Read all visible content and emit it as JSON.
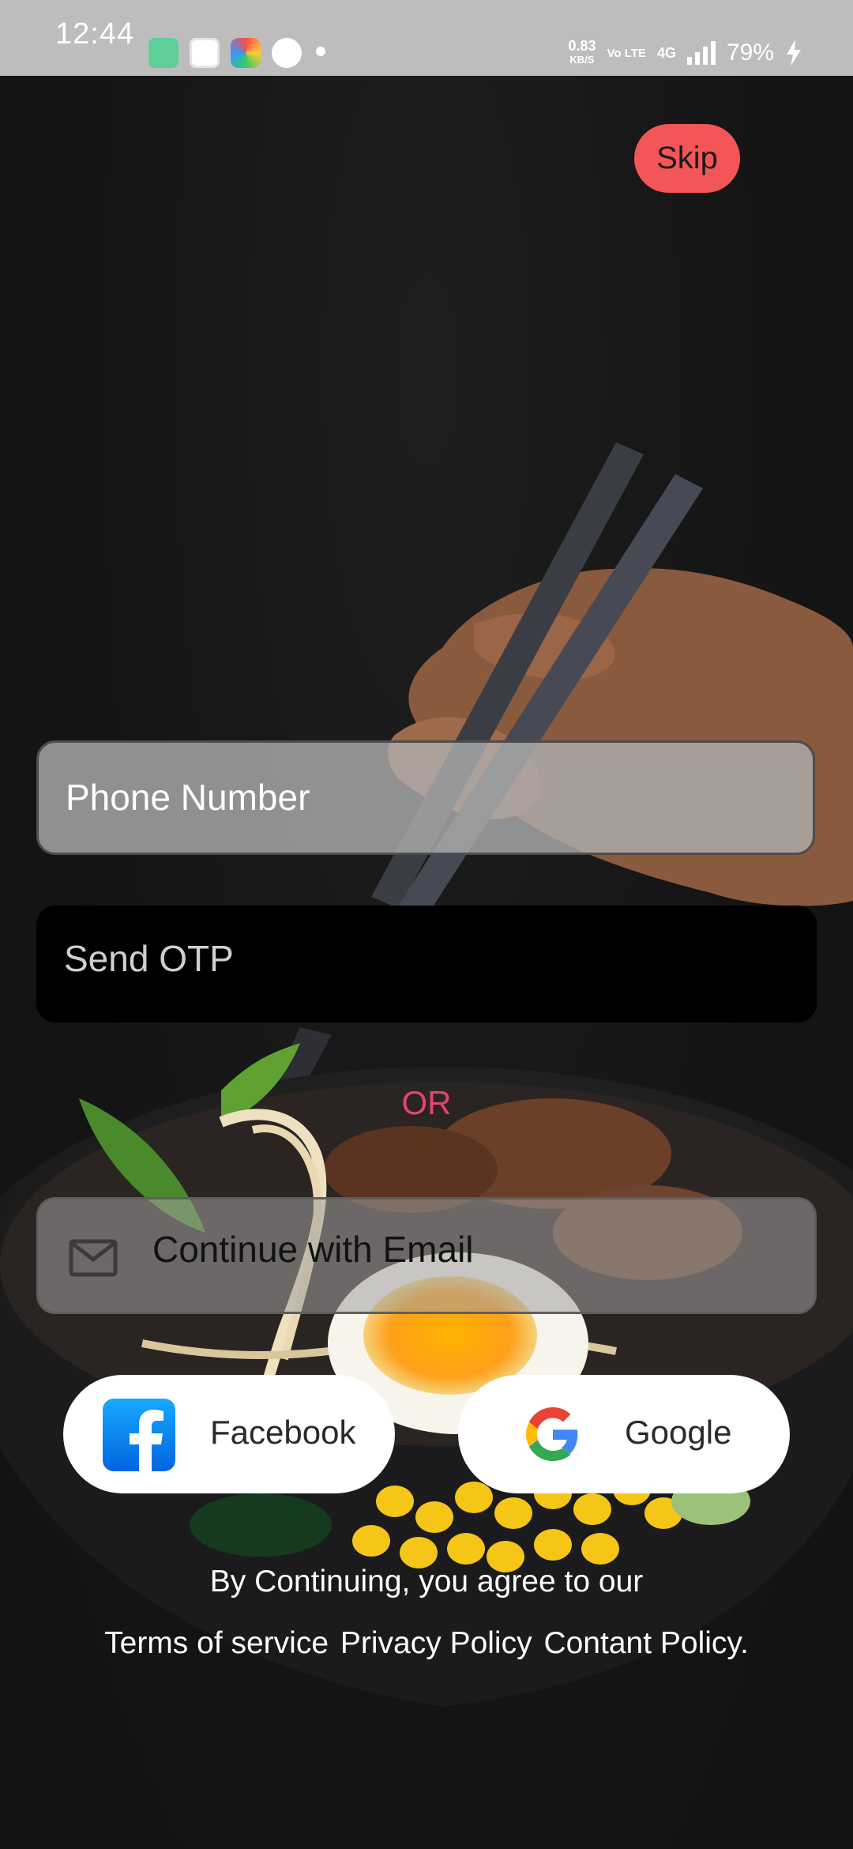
{
  "status_bar": {
    "time": "12:44",
    "net_speed": "0.83",
    "net_unit": "KB/S",
    "volte": "Vo LTE",
    "network": "4G",
    "battery": "79%"
  },
  "skip_label": "Skip",
  "phone": {
    "placeholder": "Phone Number"
  },
  "otp_button": "Send OTP",
  "or_text": "OR",
  "email_button": "Continue with Email",
  "social": {
    "facebook": "Facebook",
    "google": "Google"
  },
  "footer": {
    "agree_text": "By Continuing, you agree to our",
    "terms": "Terms of service",
    "privacy": "Privacy Policy",
    "content": "Contant Policy."
  },
  "colors": {
    "skip_bg": "#f25656",
    "or_text": "#e2456b",
    "facebook_blue": "#1877f2"
  }
}
